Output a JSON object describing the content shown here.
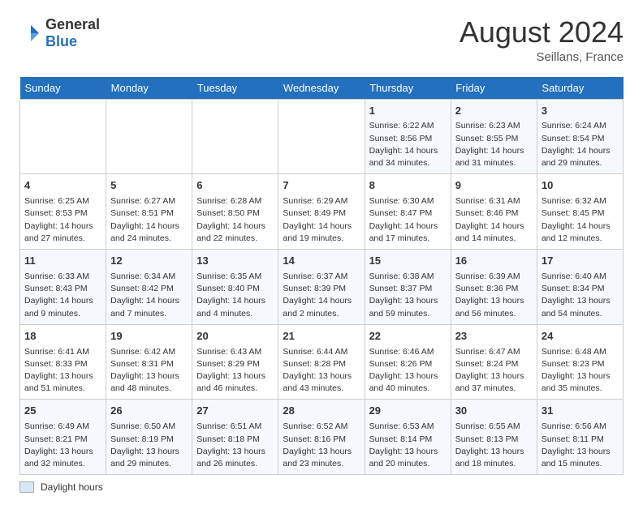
{
  "header": {
    "logo_general": "General",
    "logo_blue": "Blue",
    "title": "August 2024",
    "subtitle": "Seillans, France"
  },
  "legend": {
    "label": "Daylight hours"
  },
  "days_of_week": [
    "Sunday",
    "Monday",
    "Tuesday",
    "Wednesday",
    "Thursday",
    "Friday",
    "Saturday"
  ],
  "weeks": [
    {
      "days": [
        {
          "num": "",
          "content": ""
        },
        {
          "num": "",
          "content": ""
        },
        {
          "num": "",
          "content": ""
        },
        {
          "num": "",
          "content": ""
        },
        {
          "num": "1",
          "content": "Sunrise: 6:22 AM\nSunset: 8:56 PM\nDaylight: 14 hours and 34 minutes."
        },
        {
          "num": "2",
          "content": "Sunrise: 6:23 AM\nSunset: 8:55 PM\nDaylight: 14 hours and 31 minutes."
        },
        {
          "num": "3",
          "content": "Sunrise: 6:24 AM\nSunset: 8:54 PM\nDaylight: 14 hours and 29 minutes."
        }
      ]
    },
    {
      "days": [
        {
          "num": "4",
          "content": "Sunrise: 6:25 AM\nSunset: 8:53 PM\nDaylight: 14 hours and 27 minutes."
        },
        {
          "num": "5",
          "content": "Sunrise: 6:27 AM\nSunset: 8:51 PM\nDaylight: 14 hours and 24 minutes."
        },
        {
          "num": "6",
          "content": "Sunrise: 6:28 AM\nSunset: 8:50 PM\nDaylight: 14 hours and 22 minutes."
        },
        {
          "num": "7",
          "content": "Sunrise: 6:29 AM\nSunset: 8:49 PM\nDaylight: 14 hours and 19 minutes."
        },
        {
          "num": "8",
          "content": "Sunrise: 6:30 AM\nSunset: 8:47 PM\nDaylight: 14 hours and 17 minutes."
        },
        {
          "num": "9",
          "content": "Sunrise: 6:31 AM\nSunset: 8:46 PM\nDaylight: 14 hours and 14 minutes."
        },
        {
          "num": "10",
          "content": "Sunrise: 6:32 AM\nSunset: 8:45 PM\nDaylight: 14 hours and 12 minutes."
        }
      ]
    },
    {
      "days": [
        {
          "num": "11",
          "content": "Sunrise: 6:33 AM\nSunset: 8:43 PM\nDaylight: 14 hours and 9 minutes."
        },
        {
          "num": "12",
          "content": "Sunrise: 6:34 AM\nSunset: 8:42 PM\nDaylight: 14 hours and 7 minutes."
        },
        {
          "num": "13",
          "content": "Sunrise: 6:35 AM\nSunset: 8:40 PM\nDaylight: 14 hours and 4 minutes."
        },
        {
          "num": "14",
          "content": "Sunrise: 6:37 AM\nSunset: 8:39 PM\nDaylight: 14 hours and 2 minutes."
        },
        {
          "num": "15",
          "content": "Sunrise: 6:38 AM\nSunset: 8:37 PM\nDaylight: 13 hours and 59 minutes."
        },
        {
          "num": "16",
          "content": "Sunrise: 6:39 AM\nSunset: 8:36 PM\nDaylight: 13 hours and 56 minutes."
        },
        {
          "num": "17",
          "content": "Sunrise: 6:40 AM\nSunset: 8:34 PM\nDaylight: 13 hours and 54 minutes."
        }
      ]
    },
    {
      "days": [
        {
          "num": "18",
          "content": "Sunrise: 6:41 AM\nSunset: 8:33 PM\nDaylight: 13 hours and 51 minutes."
        },
        {
          "num": "19",
          "content": "Sunrise: 6:42 AM\nSunset: 8:31 PM\nDaylight: 13 hours and 48 minutes."
        },
        {
          "num": "20",
          "content": "Sunrise: 6:43 AM\nSunset: 8:29 PM\nDaylight: 13 hours and 46 minutes."
        },
        {
          "num": "21",
          "content": "Sunrise: 6:44 AM\nSunset: 8:28 PM\nDaylight: 13 hours and 43 minutes."
        },
        {
          "num": "22",
          "content": "Sunrise: 6:46 AM\nSunset: 8:26 PM\nDaylight: 13 hours and 40 minutes."
        },
        {
          "num": "23",
          "content": "Sunrise: 6:47 AM\nSunset: 8:24 PM\nDaylight: 13 hours and 37 minutes."
        },
        {
          "num": "24",
          "content": "Sunrise: 6:48 AM\nSunset: 8:23 PM\nDaylight: 13 hours and 35 minutes."
        }
      ]
    },
    {
      "days": [
        {
          "num": "25",
          "content": "Sunrise: 6:49 AM\nSunset: 8:21 PM\nDaylight: 13 hours and 32 minutes."
        },
        {
          "num": "26",
          "content": "Sunrise: 6:50 AM\nSunset: 8:19 PM\nDaylight: 13 hours and 29 minutes."
        },
        {
          "num": "27",
          "content": "Sunrise: 6:51 AM\nSunset: 8:18 PM\nDaylight: 13 hours and 26 minutes."
        },
        {
          "num": "28",
          "content": "Sunrise: 6:52 AM\nSunset: 8:16 PM\nDaylight: 13 hours and 23 minutes."
        },
        {
          "num": "29",
          "content": "Sunrise: 6:53 AM\nSunset: 8:14 PM\nDaylight: 13 hours and 20 minutes."
        },
        {
          "num": "30",
          "content": "Sunrise: 6:55 AM\nSunset: 8:13 PM\nDaylight: 13 hours and 18 minutes."
        },
        {
          "num": "31",
          "content": "Sunrise: 6:56 AM\nSunset: 8:11 PM\nDaylight: 13 hours and 15 minutes."
        }
      ]
    }
  ]
}
